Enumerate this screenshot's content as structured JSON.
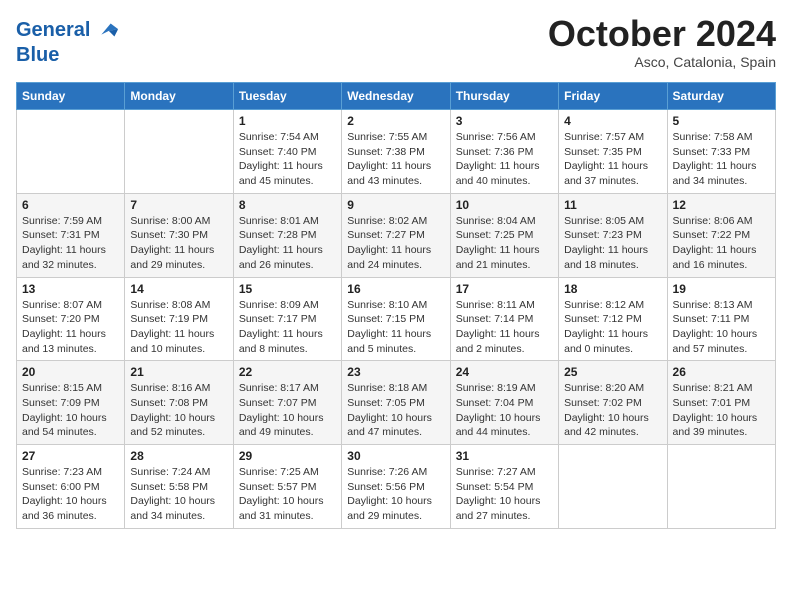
{
  "header": {
    "logo_line1": "General",
    "logo_line2": "Blue",
    "month": "October 2024",
    "location": "Asco, Catalonia, Spain"
  },
  "weekdays": [
    "Sunday",
    "Monday",
    "Tuesday",
    "Wednesday",
    "Thursday",
    "Friday",
    "Saturday"
  ],
  "weeks": [
    [
      {
        "day": "",
        "detail": ""
      },
      {
        "day": "",
        "detail": ""
      },
      {
        "day": "1",
        "detail": "Sunrise: 7:54 AM\nSunset: 7:40 PM\nDaylight: 11 hours and 45 minutes."
      },
      {
        "day": "2",
        "detail": "Sunrise: 7:55 AM\nSunset: 7:38 PM\nDaylight: 11 hours and 43 minutes."
      },
      {
        "day": "3",
        "detail": "Sunrise: 7:56 AM\nSunset: 7:36 PM\nDaylight: 11 hours and 40 minutes."
      },
      {
        "day": "4",
        "detail": "Sunrise: 7:57 AM\nSunset: 7:35 PM\nDaylight: 11 hours and 37 minutes."
      },
      {
        "day": "5",
        "detail": "Sunrise: 7:58 AM\nSunset: 7:33 PM\nDaylight: 11 hours and 34 minutes."
      }
    ],
    [
      {
        "day": "6",
        "detail": "Sunrise: 7:59 AM\nSunset: 7:31 PM\nDaylight: 11 hours and 32 minutes."
      },
      {
        "day": "7",
        "detail": "Sunrise: 8:00 AM\nSunset: 7:30 PM\nDaylight: 11 hours and 29 minutes."
      },
      {
        "day": "8",
        "detail": "Sunrise: 8:01 AM\nSunset: 7:28 PM\nDaylight: 11 hours and 26 minutes."
      },
      {
        "day": "9",
        "detail": "Sunrise: 8:02 AM\nSunset: 7:27 PM\nDaylight: 11 hours and 24 minutes."
      },
      {
        "day": "10",
        "detail": "Sunrise: 8:04 AM\nSunset: 7:25 PM\nDaylight: 11 hours and 21 minutes."
      },
      {
        "day": "11",
        "detail": "Sunrise: 8:05 AM\nSunset: 7:23 PM\nDaylight: 11 hours and 18 minutes."
      },
      {
        "day": "12",
        "detail": "Sunrise: 8:06 AM\nSunset: 7:22 PM\nDaylight: 11 hours and 16 minutes."
      }
    ],
    [
      {
        "day": "13",
        "detail": "Sunrise: 8:07 AM\nSunset: 7:20 PM\nDaylight: 11 hours and 13 minutes."
      },
      {
        "day": "14",
        "detail": "Sunrise: 8:08 AM\nSunset: 7:19 PM\nDaylight: 11 hours and 10 minutes."
      },
      {
        "day": "15",
        "detail": "Sunrise: 8:09 AM\nSunset: 7:17 PM\nDaylight: 11 hours and 8 minutes."
      },
      {
        "day": "16",
        "detail": "Sunrise: 8:10 AM\nSunset: 7:15 PM\nDaylight: 11 hours and 5 minutes."
      },
      {
        "day": "17",
        "detail": "Sunrise: 8:11 AM\nSunset: 7:14 PM\nDaylight: 11 hours and 2 minutes."
      },
      {
        "day": "18",
        "detail": "Sunrise: 8:12 AM\nSunset: 7:12 PM\nDaylight: 11 hours and 0 minutes."
      },
      {
        "day": "19",
        "detail": "Sunrise: 8:13 AM\nSunset: 7:11 PM\nDaylight: 10 hours and 57 minutes."
      }
    ],
    [
      {
        "day": "20",
        "detail": "Sunrise: 8:15 AM\nSunset: 7:09 PM\nDaylight: 10 hours and 54 minutes."
      },
      {
        "day": "21",
        "detail": "Sunrise: 8:16 AM\nSunset: 7:08 PM\nDaylight: 10 hours and 52 minutes."
      },
      {
        "day": "22",
        "detail": "Sunrise: 8:17 AM\nSunset: 7:07 PM\nDaylight: 10 hours and 49 minutes."
      },
      {
        "day": "23",
        "detail": "Sunrise: 8:18 AM\nSunset: 7:05 PM\nDaylight: 10 hours and 47 minutes."
      },
      {
        "day": "24",
        "detail": "Sunrise: 8:19 AM\nSunset: 7:04 PM\nDaylight: 10 hours and 44 minutes."
      },
      {
        "day": "25",
        "detail": "Sunrise: 8:20 AM\nSunset: 7:02 PM\nDaylight: 10 hours and 42 minutes."
      },
      {
        "day": "26",
        "detail": "Sunrise: 8:21 AM\nSunset: 7:01 PM\nDaylight: 10 hours and 39 minutes."
      }
    ],
    [
      {
        "day": "27",
        "detail": "Sunrise: 7:23 AM\nSunset: 6:00 PM\nDaylight: 10 hours and 36 minutes."
      },
      {
        "day": "28",
        "detail": "Sunrise: 7:24 AM\nSunset: 5:58 PM\nDaylight: 10 hours and 34 minutes."
      },
      {
        "day": "29",
        "detail": "Sunrise: 7:25 AM\nSunset: 5:57 PM\nDaylight: 10 hours and 31 minutes."
      },
      {
        "day": "30",
        "detail": "Sunrise: 7:26 AM\nSunset: 5:56 PM\nDaylight: 10 hours and 29 minutes."
      },
      {
        "day": "31",
        "detail": "Sunrise: 7:27 AM\nSunset: 5:54 PM\nDaylight: 10 hours and 27 minutes."
      },
      {
        "day": "",
        "detail": ""
      },
      {
        "day": "",
        "detail": ""
      }
    ]
  ]
}
